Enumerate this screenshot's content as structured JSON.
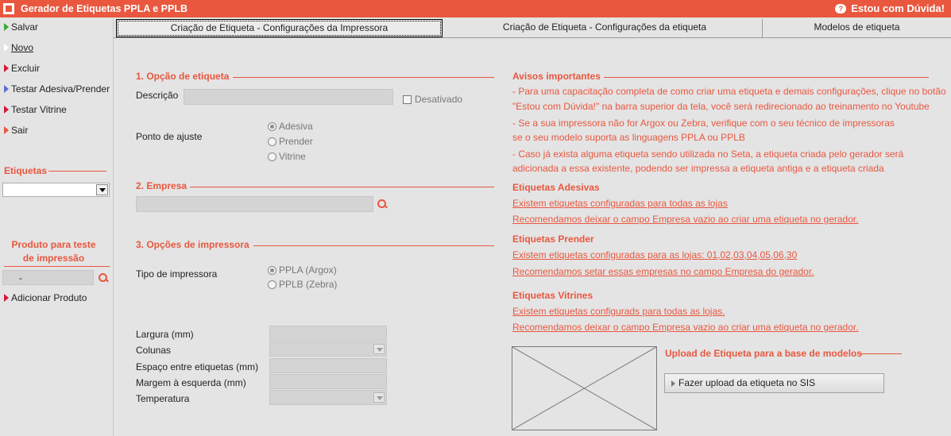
{
  "window": {
    "title": "Gerador de Etiquetas PPLA e PPLB",
    "help_label": "Estou com Dúvida!"
  },
  "sidebar": {
    "actions": [
      {
        "label": "Salvar",
        "underline": ""
      },
      {
        "label": "Novo"
      },
      {
        "label": "Excluir"
      },
      {
        "label": "Testar Adesiva/Prender"
      },
      {
        "label": "Testar Vitrine"
      },
      {
        "label": "Sair"
      }
    ],
    "etiquetas_label": "Etiquetas",
    "etiquetas_value": "",
    "produto_label_1": "Produto para teste",
    "produto_label_2": "de impressão",
    "produto_value": "-",
    "add_product_label": "Adicionar Produto"
  },
  "tabs": [
    {
      "label": "Criação de Etiqueta - Configurações da Impressora",
      "active": true
    },
    {
      "label": "Criação de Etiqueta - Configurações da etiqueta"
    },
    {
      "label": "Modelos de etiqueta"
    }
  ],
  "form": {
    "section1_title": "1. Opção de etiqueta",
    "descricao_label": "Descrição",
    "descricao_value": "",
    "desativado_label": "Desativado",
    "ponto_label": "Ponto de ajuste",
    "ponto_options": [
      "Adesiva",
      "Prender",
      "Vitrine"
    ],
    "ponto_selected": "Adesiva",
    "section2_title": "2. Empresa",
    "empresa_value": "",
    "section3_title": "3. Opções de impressora",
    "tipo_label": "Tipo de impressora",
    "tipo_options": [
      "PPLA (Argox)",
      "PPLB (Zebra)"
    ],
    "tipo_selected": "PPLA (Argox)",
    "largura_label": "Largura (mm)",
    "colunas_label": "Colunas",
    "espaco_label": "Espaço entre etiquetas (mm)",
    "margem_label": "Margem à esquerda (mm)",
    "temperatura_label": "Temperatura"
  },
  "notices": {
    "title": "Avisos importantes",
    "lines": [
      "- Para uma capacitação completa de como criar uma etiqueta e demais configurações, clique no botão",
      "\"Estou com Dúvida!\" na barra superior da tela, você será redirecionado ao treinamento no Youtube",
      "- Se a sua impressora não for Argox ou Zebra, verifique com o seu técnico de impressoras",
      "se o seu modelo suporta as linguagens PPLA ou PPLB",
      "- Caso já exista alguma etiqueta sendo utilizada no Seta, a etiqueta criada pelo gerador será",
      "adicionada a essa existente, podendo ser impressa a etiqueta antiga e a etiqueta criada"
    ],
    "adesivas_title": "Etiquetas Adesivas",
    "adesivas_links": [
      "Existem etiquetas configuradas para todas as lojas",
      "Recomendamos deixar o campo Empresa vazio ao criar uma etiqueta no gerador."
    ],
    "prender_title": "Etiquetas Prender",
    "prender_links": [
      "Existem etiquetas configuradas para as lojas: 01,02,03,04,05,06,30",
      "Recomendamos setar essas empresas no campo Empresa do gerador."
    ],
    "vitrines_title": "Etiquetas Vitrines",
    "vitrines_links": [
      "Existem etiquetas configurads para todas as lojas.",
      "Recomendamos deixar o campo Empresa vazio ao criar uma etiqueta no gerador."
    ],
    "upload_title": "Upload de Etiqueta para a base de modelos",
    "upload_button": "Fazer upload da etiqueta no SIS"
  },
  "colors": {
    "accent": "#e9573f",
    "background": "#e4e4e4"
  }
}
